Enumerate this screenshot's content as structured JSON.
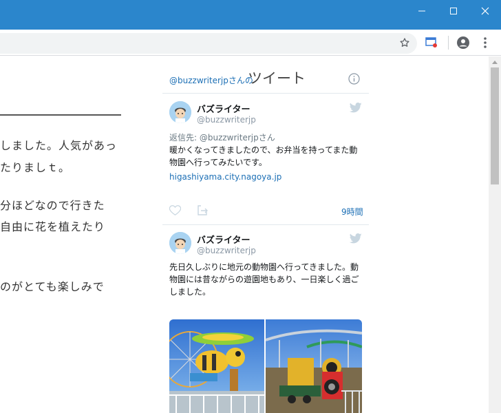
{
  "window": {
    "controls": [
      "minimize-icon",
      "maximize-icon",
      "close-icon"
    ]
  },
  "toolbar": {
    "icons": [
      "star-icon",
      "cast-extension-icon",
      "profile-icon",
      "menu-icon"
    ]
  },
  "article": {
    "lines": [
      "しました。人気があっ",
      "たりましｔ。",
      "分ほどなので行きた",
      "自由に花を植えたり",
      "のがとても楽しみで"
    ]
  },
  "timeline": {
    "header_small": "@buzzwriterjpさんの",
    "header_big": "ツイート",
    "info_icon": "info-icon"
  },
  "tweets": [
    {
      "name": "バズライター",
      "handle": "@buzzwriterjp",
      "reply_to": "返信先: @buzzwriterjpさん",
      "text_lines": [
        "暖かくなってきましたので、お弁当を持ってまた動",
        "物園へ行ってみたいです。"
      ],
      "link": "higashiyama.city.nagoya.jp",
      "time": "9時間"
    },
    {
      "name": "バズライター",
      "handle": "@buzzwriterjp",
      "text_lines": [
        "先日久しぶりに地元の動物園へ行ってきました。動",
        "物園には昔ながらの遊園地もあり、一日楽しく過ご",
        "しました。"
      ]
    }
  ],
  "colors": {
    "titlebar": "#2b86cc",
    "link": "#1c6fb5",
    "twitter_blue": "#1da1f2"
  }
}
